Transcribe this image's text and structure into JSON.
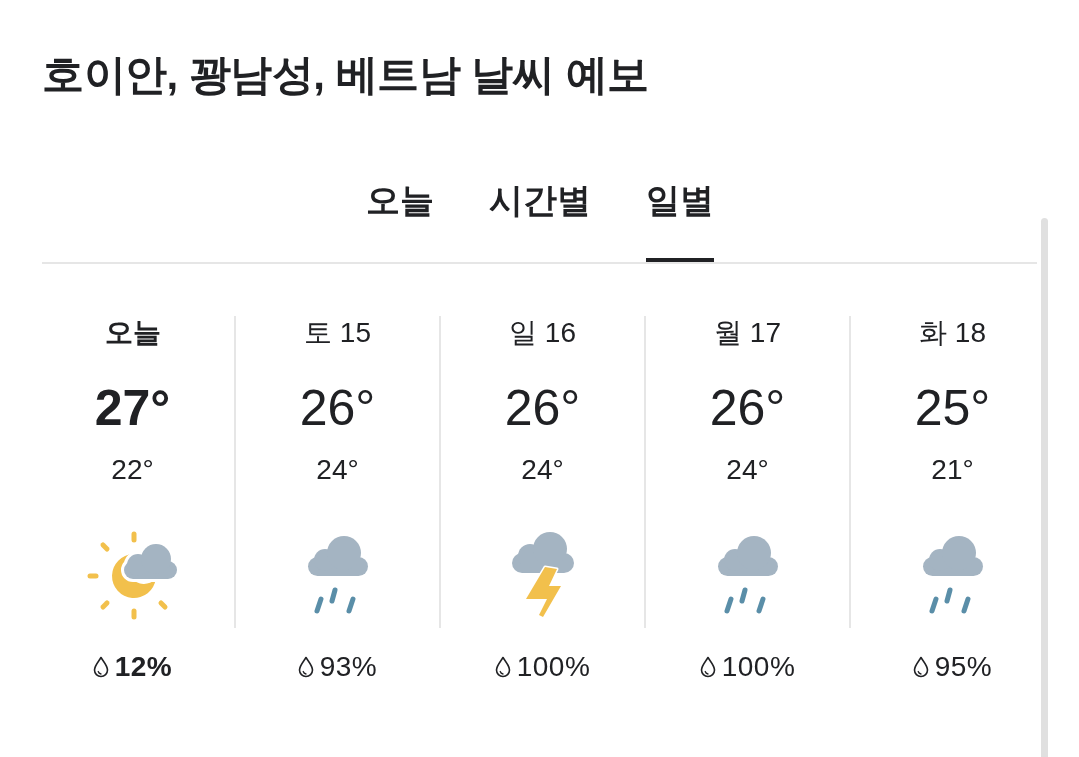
{
  "title": "호이안, 꽝남성, 베트남 날씨 예보",
  "tabs": [
    {
      "label": "오늘",
      "selected": false
    },
    {
      "label": "시간별",
      "selected": false
    },
    {
      "label": "일별",
      "selected": true
    }
  ],
  "days": [
    {
      "label": "오늘",
      "current": true,
      "high": "27°",
      "low": "22°",
      "kind": "partly-cloudy",
      "precipitation": "12%"
    },
    {
      "label": "토 15",
      "current": false,
      "high": "26°",
      "low": "24°",
      "kind": "rain",
      "precipitation": "93%"
    },
    {
      "label": "일 16",
      "current": false,
      "high": "26°",
      "low": "24°",
      "kind": "thunderstorm",
      "precipitation": "100%"
    },
    {
      "label": "월 17",
      "current": false,
      "high": "26°",
      "low": "24°",
      "kind": "rain",
      "precipitation": "100%"
    },
    {
      "label": "화 18",
      "current": false,
      "high": "25°",
      "low": "21°",
      "kind": "rain",
      "precipitation": "95%"
    }
  ]
}
